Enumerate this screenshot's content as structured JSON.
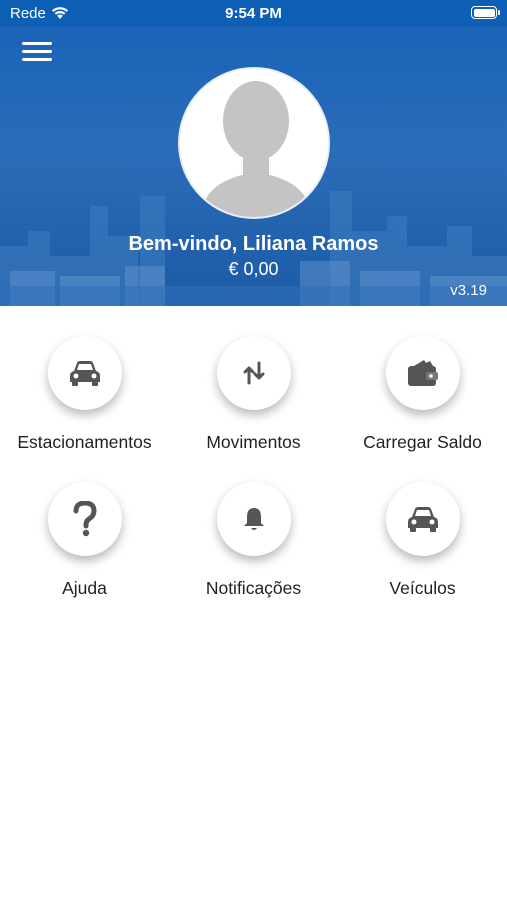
{
  "status_bar": {
    "carrier": "Rede",
    "time": "9:54 PM"
  },
  "header": {
    "welcome": "Bem-vindo, Liliana Ramos",
    "balance": "€ 0,00",
    "version": "v3.19",
    "accent_color": "#1a63b8"
  },
  "menu": [
    {
      "label": "Estacionamentos",
      "icon": "car-icon"
    },
    {
      "label": "Movimentos",
      "icon": "swap-arrows-icon"
    },
    {
      "label": "Carregar Saldo",
      "icon": "wallet-icon"
    },
    {
      "label": "Ajuda",
      "icon": "question-mark-icon"
    },
    {
      "label": "Notificações",
      "icon": "bell-icon"
    },
    {
      "label": "Veículos",
      "icon": "car-icon"
    }
  ],
  "colors": {
    "icon": "#555555",
    "label": "#222222"
  }
}
